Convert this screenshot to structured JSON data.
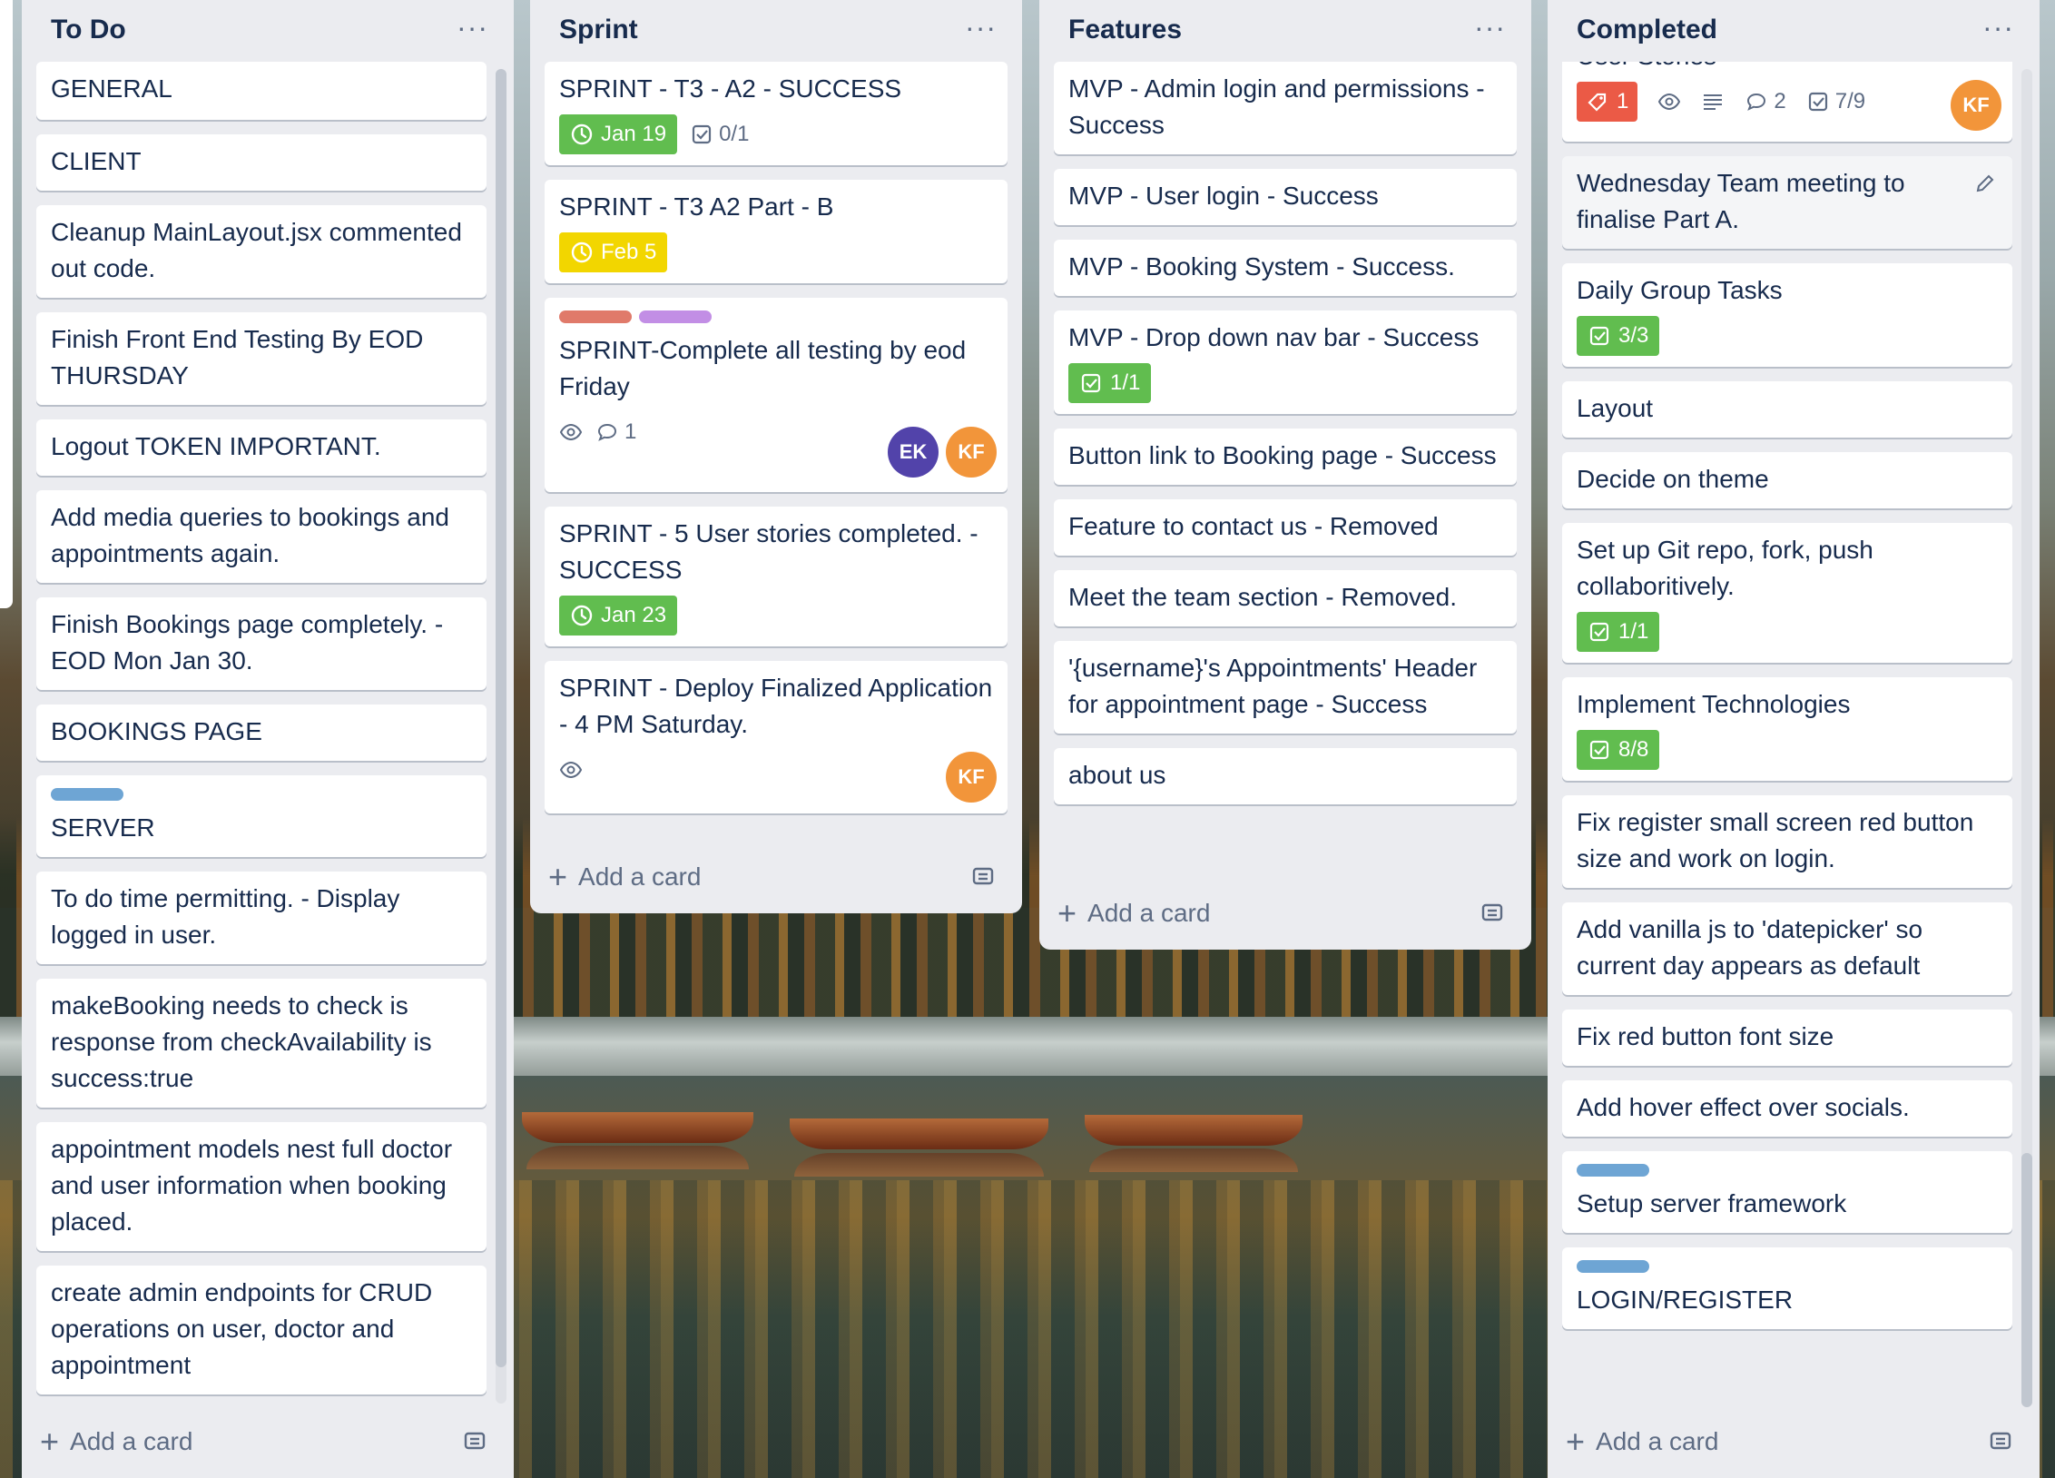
{
  "colors": {
    "list_bg": "#ebecf0",
    "card_bg": "#ffffff",
    "text": "#172b4d",
    "muted": "#5e6c84",
    "green": "#61bd4f",
    "yellow": "#f2d600",
    "red": "#eb5a46",
    "label_blue": "#6ea5d4",
    "label_red": "#e07a6a",
    "label_purple": "#c28ee5",
    "avatar_purple": "#5243aa",
    "avatar_orange": "#f2953a"
  },
  "add_card_label": "Add a card",
  "list_menu": "···",
  "lists": [
    {
      "title": "To Do",
      "cards": [
        {
          "title": "GENERAL"
        },
        {
          "title": "CLIENT"
        },
        {
          "title": "Cleanup MainLayout.jsx commented out code."
        },
        {
          "title": "Finish Front End Testing By EOD THURSDAY"
        },
        {
          "title": "Logout TOKEN IMPORTANT."
        },
        {
          "title": "Add media queries to bookings and appointments again."
        },
        {
          "title": "Finish Bookings page completely. - EOD Mon Jan 30."
        },
        {
          "title": "BOOKINGS PAGE"
        },
        {
          "title": "SERVER",
          "labels": [
            "label_blue"
          ]
        },
        {
          "title": "To do time permitting. - Display logged in user."
        },
        {
          "title": "makeBooking needs to check is response from checkAvailability is success:true"
        },
        {
          "title": "appointment models nest full doctor and user information when booking placed."
        },
        {
          "title": "create admin endpoints for CRUD operations on user, doctor and appointment"
        }
      ]
    },
    {
      "title": "Sprint",
      "cards": [
        {
          "title": "SPRINT - T3 - A2 - SUCCESS",
          "date": "Jan 19",
          "date_color": "green",
          "checklist": "0/1"
        },
        {
          "title": "SPRINT - T3 A2 Part - B",
          "date": "Feb 5",
          "date_color": "yellow"
        },
        {
          "title": "SPRINT-Complete all testing by eod Friday",
          "labels": [
            "label_red",
            "label_purple"
          ],
          "watch": true,
          "comments": "1",
          "members": [
            "EK",
            "KF"
          ]
        },
        {
          "title": "SPRINT - 5 User stories completed. - SUCCESS",
          "date": "Jan 23",
          "date_color": "green"
        },
        {
          "title": "SPRINT - Deploy Finalized Application - 4 PM Saturday.",
          "watch": true,
          "members": [
            "KF"
          ]
        }
      ]
    },
    {
      "title": "Features",
      "cards": [
        {
          "title": "MVP - Admin login and permissions - Success"
        },
        {
          "title": "MVP - User login - Success"
        },
        {
          "title": "MVP - Booking System - Success."
        },
        {
          "title": "MVP - Drop down nav bar - Success",
          "checklist_done": "1/1"
        },
        {
          "title": "Button link to Booking page - Success"
        },
        {
          "title": "Feature to contact us - Removed"
        },
        {
          "title": "Meet the team section - Removed."
        },
        {
          "title": "'{username}'s Appointments' Header for appointment page - Success"
        },
        {
          "title": "about us"
        }
      ]
    },
    {
      "title": "Completed",
      "cards": [
        {
          "title": "User Stories",
          "votes": "1",
          "comments": "2",
          "checklist": "7/9",
          "members": [
            "KF"
          ]
        },
        {
          "title": "Wednesday Team meeting to finalise Part A."
        },
        {
          "title": "Daily Group Tasks",
          "checklist_done": "3/3"
        },
        {
          "title": "Layout"
        },
        {
          "title": "Decide on theme"
        },
        {
          "title": "Set up Git repo, fork, push collaboritively.",
          "checklist_done": "1/1"
        },
        {
          "title": "Implement Technologies",
          "checklist_done": "8/8"
        },
        {
          "title": "Fix register small screen red button size and work on login."
        },
        {
          "title": "Add vanilla js to 'datepicker' so current day appears as default"
        },
        {
          "title": "Fix red button font size"
        },
        {
          "title": "Add hover effect over socials."
        },
        {
          "title": "Setup server framework",
          "labels": [
            "label_blue"
          ]
        },
        {
          "title": "LOGIN/REGISTER",
          "labels": [
            "label_blue"
          ]
        }
      ]
    }
  ]
}
